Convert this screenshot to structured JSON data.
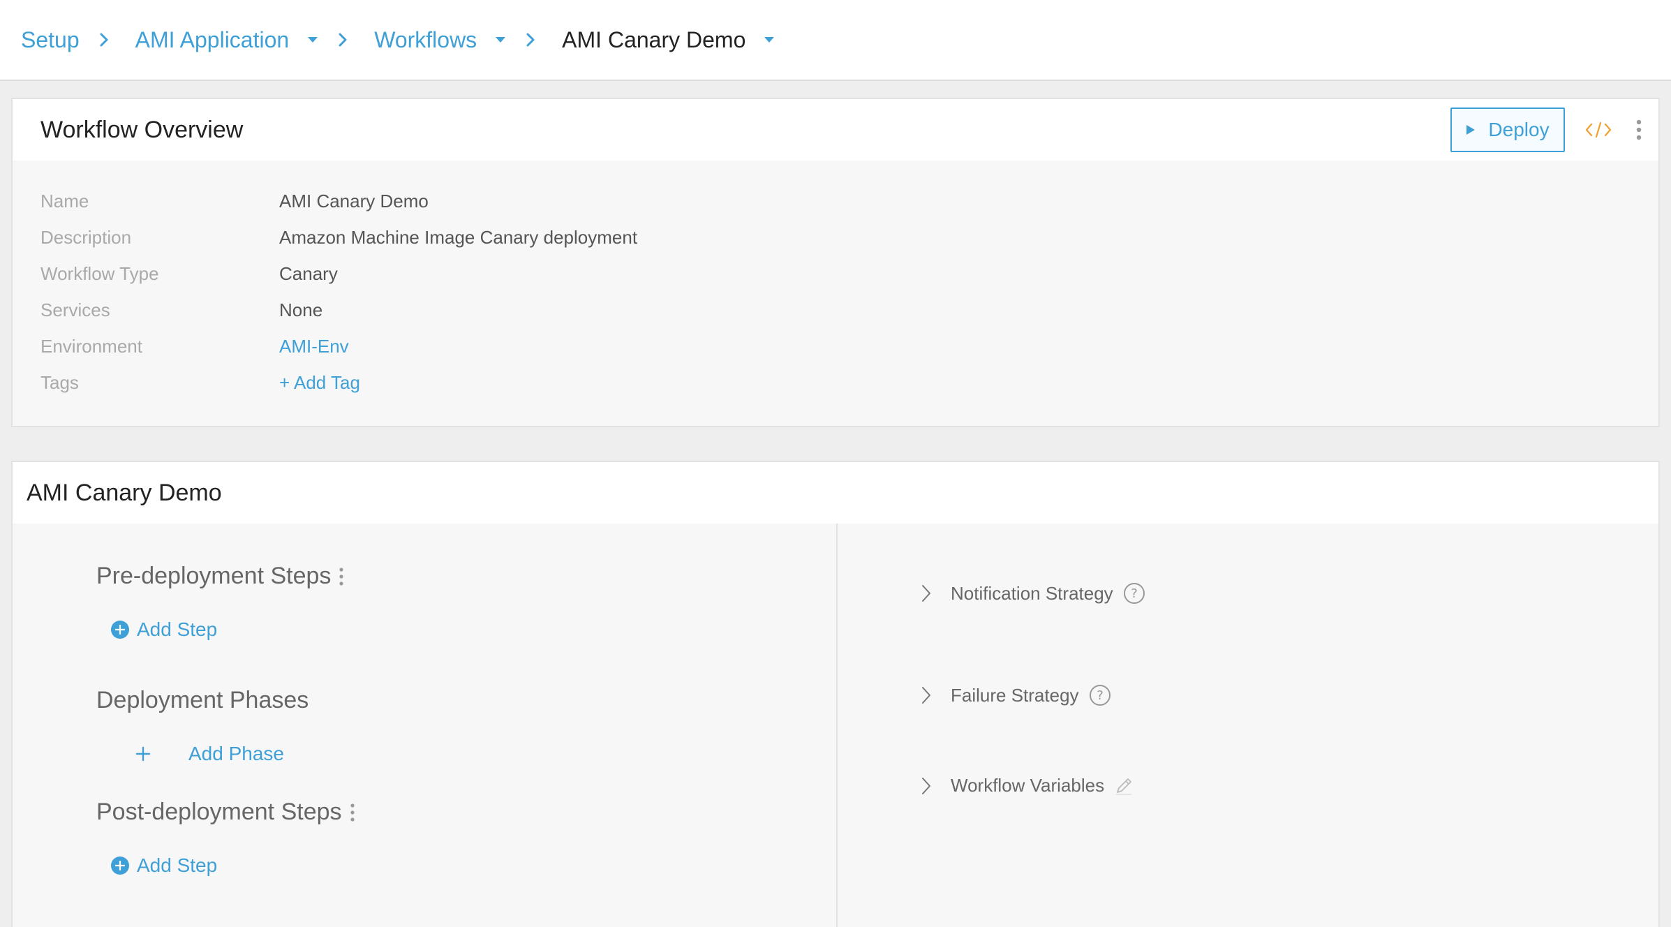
{
  "breadcrumb": {
    "setup": "Setup",
    "application": "AMI Application",
    "workflows": "Workflows",
    "current": "AMI Canary Demo"
  },
  "overview": {
    "title": "Workflow Overview",
    "deploy_label": "Deploy",
    "fields": [
      {
        "label": "Name",
        "value": "AMI Canary Demo"
      },
      {
        "label": "Description",
        "value": "Amazon Machine Image Canary deployment"
      },
      {
        "label": "Workflow Type",
        "value": "Canary"
      },
      {
        "label": "Services",
        "value": "None"
      },
      {
        "label": "Environment",
        "value": "AMI-Env"
      },
      {
        "label": "Tags",
        "value": "+ Add Tag"
      }
    ]
  },
  "workflow": {
    "title": "AMI Canary Demo",
    "pre_deployment": {
      "title": "Pre-deployment Steps",
      "add_label": "Add Step"
    },
    "phases": {
      "title": "Deployment Phases",
      "add_label": "Add Phase"
    },
    "post_deployment": {
      "title": "Post-deployment Steps",
      "add_label": "Add Step"
    },
    "right": {
      "notification": "Notification Strategy",
      "failure": "Failure Strategy",
      "variables": "Workflow Variables"
    }
  },
  "colors": {
    "accent": "#3ea0d6",
    "code_icon": "#f0a030"
  },
  "icons": [
    "chevron-right-icon",
    "caret-down-icon",
    "play-icon",
    "code-icon",
    "kebab-icon",
    "plus-circle-icon",
    "plus-icon",
    "help-icon",
    "pencil-icon"
  ]
}
